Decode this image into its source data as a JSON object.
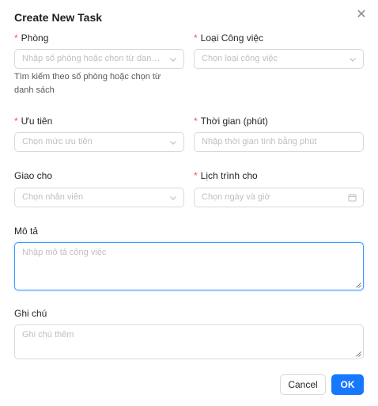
{
  "modal": {
    "title": "Create New Task",
    "close_icon": "close-icon"
  },
  "fields": {
    "room": {
      "label": "Phòng",
      "required_mark": "*",
      "placeholder": "Nhập số phòng hoặc chọn từ danh sách",
      "help_line1": "Tìm kiếm theo số phòng hoặc chọn từ",
      "help_line2": "danh sách",
      "icon": "chevron-down-icon"
    },
    "task_type": {
      "label": "Loại Công việc",
      "required_mark": "*",
      "placeholder": "Chọn loại công việc",
      "icon": "chevron-down-icon"
    },
    "priority": {
      "label": "Ưu tiên",
      "required_mark": "*",
      "placeholder": "Chọn mức ưu tiên",
      "icon": "chevron-down-icon"
    },
    "duration": {
      "label": "Thời gian (phút)",
      "required_mark": "*",
      "placeholder": "Nhập thời gian tính bằng phút"
    },
    "assignee": {
      "label": "Giao cho",
      "placeholder": "Chọn nhân viên",
      "icon": "chevron-down-icon"
    },
    "schedule": {
      "label": "Lịch trình cho",
      "required_mark": "*",
      "placeholder": "Chọn ngày và giờ",
      "icon": "calendar-icon"
    },
    "description": {
      "label": "Mô tả",
      "placeholder": "Nhập mô tả công việc"
    },
    "notes": {
      "label": "Ghi chú",
      "placeholder": "Ghi chú thêm"
    }
  },
  "footer": {
    "cancel_label": "Cancel",
    "ok_label": "OK"
  },
  "colors": {
    "primary": "#1677ff",
    "required": "#ff4d4f",
    "focus_border": "#4096ff"
  }
}
